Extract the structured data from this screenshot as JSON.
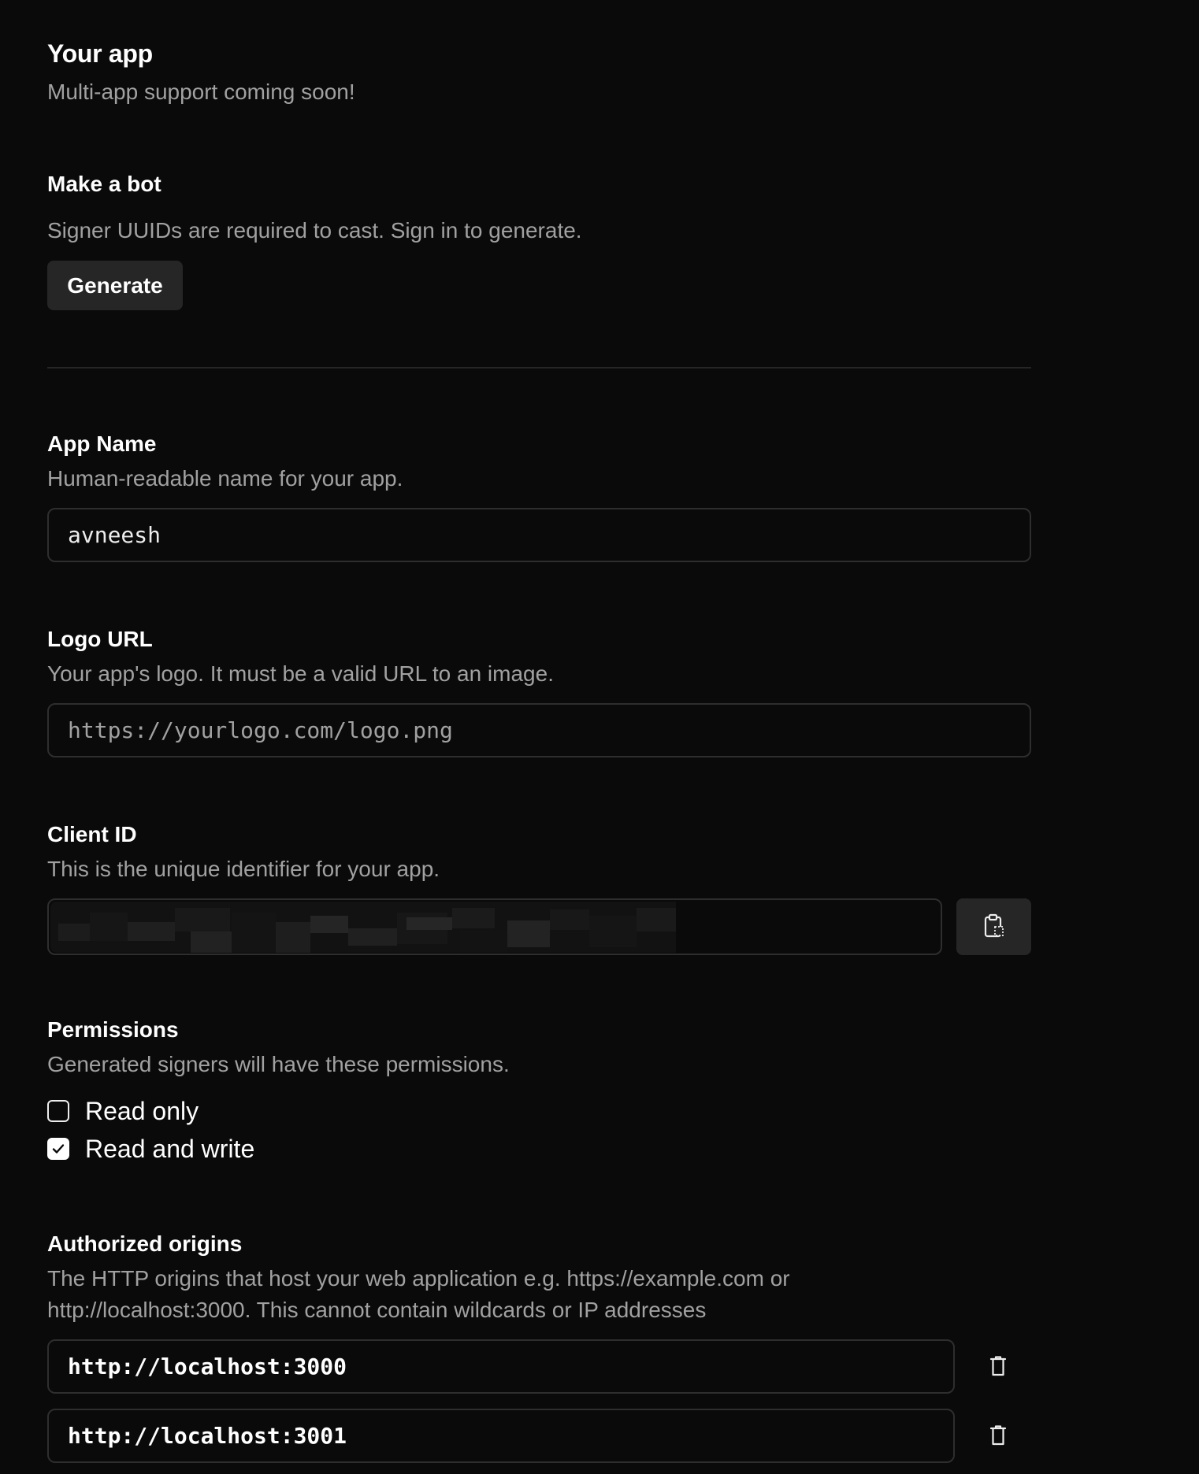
{
  "header": {
    "title": "Your app",
    "subtitle": "Multi-app support coming soon!"
  },
  "bot": {
    "title": "Make a bot",
    "description": "Signer UUIDs are required to cast. Sign in to generate.",
    "button_label": "Generate"
  },
  "app_name": {
    "label": "App Name",
    "description": "Human-readable name for your app.",
    "value": "avneesh"
  },
  "logo_url": {
    "label": "Logo URL",
    "description": "Your app's logo. It must be a valid URL to an image.",
    "value": "",
    "placeholder": "https://yourlogo.com/logo.png"
  },
  "client_id": {
    "label": "Client ID",
    "description": "This is the unique identifier for your app.",
    "copy_icon": "clipboard-copy-icon"
  },
  "permissions": {
    "label": "Permissions",
    "description": "Generated signers will have these permissions.",
    "options": [
      {
        "label": "Read only",
        "checked": false
      },
      {
        "label": "Read and write",
        "checked": true
      }
    ]
  },
  "origins": {
    "label": "Authorized origins",
    "description_line1": "The HTTP origins that host your web application e.g. https://example.com or",
    "description_line2": "http://localhost:3000. This cannot contain wildcards or IP addresses",
    "items": [
      {
        "value": "http://localhost:3000"
      },
      {
        "value": "http://localhost:3001"
      }
    ],
    "delete_icon": "trash-icon"
  }
}
